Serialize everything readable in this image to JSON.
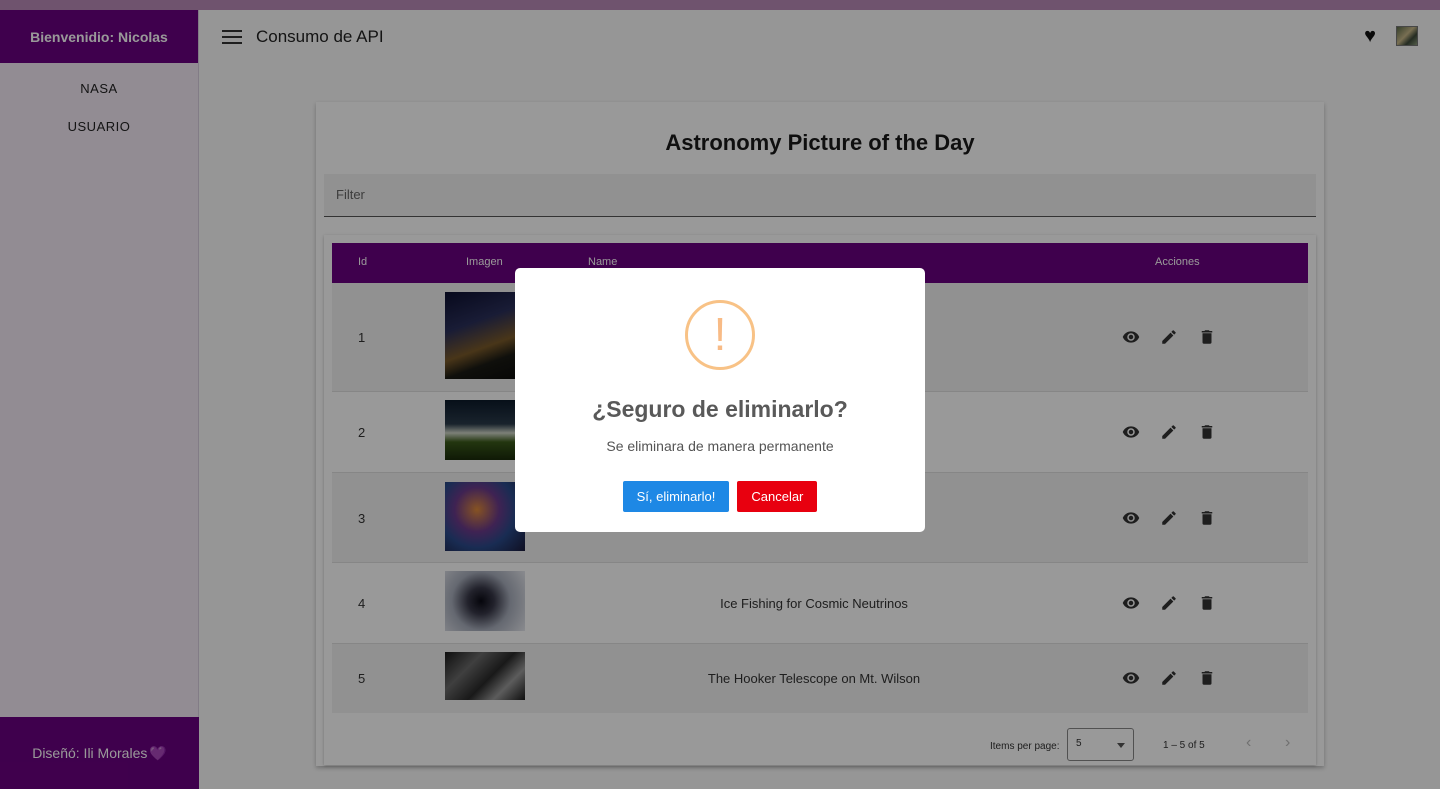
{
  "sidebar": {
    "welcome": "Bienvenidio: Nicolas",
    "items": [
      {
        "label": "NASA"
      },
      {
        "label": "USUARIO"
      }
    ],
    "footer": "Diseñó: Ili Morales",
    "footer_emoji": "💜"
  },
  "toolbar": {
    "title": "Consumo de API",
    "menu_icon": "menu-icon",
    "favorite_icon": "heart-icon"
  },
  "card": {
    "title": "Astronomy Picture of the Day",
    "filter_placeholder": "Filter"
  },
  "table": {
    "columns": [
      "Id",
      "Imagen",
      "Name",
      "Acciones"
    ],
    "rows": [
      {
        "id": "1",
        "name": ""
      },
      {
        "id": "2",
        "name": ""
      },
      {
        "id": "3",
        "name": ""
      },
      {
        "id": "4",
        "name": "Ice Fishing for Cosmic Neutrinos"
      },
      {
        "id": "5",
        "name": "The Hooker Telescope on Mt. Wilson"
      }
    ],
    "action_icons": [
      "eye-icon",
      "pencil-icon",
      "trash-icon"
    ]
  },
  "paginator": {
    "items_per_page_label": "Items per page:",
    "page_size": "5",
    "range": "1 – 5 of 5"
  },
  "dialog": {
    "icon": "!",
    "title": "¿Seguro de eliminarlo?",
    "text": "Se eliminara de manera permanente",
    "confirm_label": "Sí, eliminarlo!",
    "cancel_label": "Cancelar"
  },
  "colors": {
    "primary": "#6a0080",
    "confirm": "#1e88e5",
    "cancel": "#e8000f",
    "warning": "#f8bb86"
  }
}
